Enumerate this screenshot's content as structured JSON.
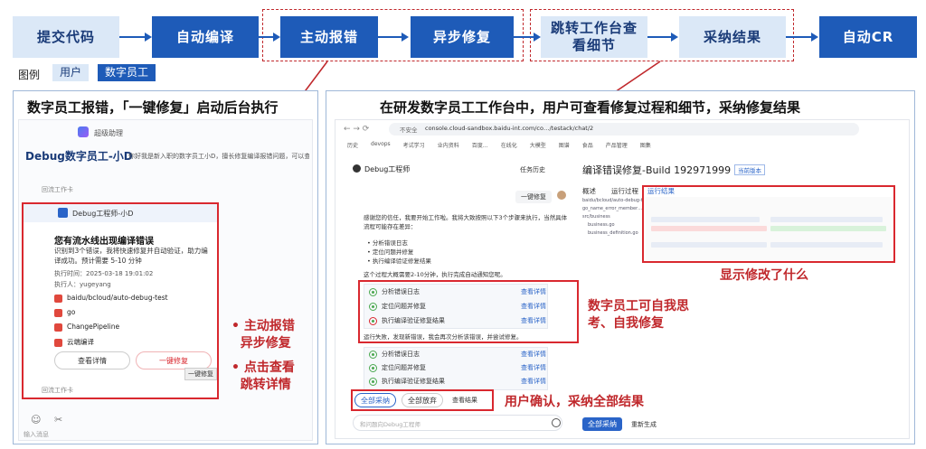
{
  "flow": {
    "steps": [
      {
        "label": "提交代码",
        "role": "user"
      },
      {
        "label": "自动编译",
        "role": "employee"
      },
      {
        "label": "主动报错",
        "role": "employee"
      },
      {
        "label": "异步修复",
        "role": "employee"
      },
      {
        "label": "跳转工作台查看细节",
        "role": "user"
      },
      {
        "label": "采纳结果",
        "role": "user"
      },
      {
        "label": "自动CR",
        "role": "employee"
      }
    ]
  },
  "legend": {
    "title": "图例",
    "user": "用户",
    "employee": "数字员工"
  },
  "colors": {
    "user_fill": "#dbe8f7",
    "employee_fill": "#1e5bb8",
    "accent_red": "#c0282c"
  },
  "left_panel": {
    "title": "数字员工报错，「一键修复」启动后台执行",
    "app_name": "超级助理",
    "chat_title": "Debug数字员工-小D",
    "chat_intro": "你好我是新入职的数字员工小D，擅长修复编译报错问题，可以查...",
    "back_label_top": "回流工作卡",
    "card": {
      "sender": "Debug工程师-小D",
      "heading": "您有流水线出现编译错误",
      "message": "识别到3个错误，我将快速修复并自动验证，助力编译成功。预计需要 5-10 分钟",
      "exec_time": "执行时间：2025-03-18 19:01:02",
      "executor": "执行人：yugeyang",
      "repo": "baidu/bcloud/auto-debug-test",
      "lang": "go",
      "pipeline": "ChangePipeline",
      "env": "云端编译",
      "detail_button": "查看详情",
      "fix_button": "一键修复",
      "tooltip": "一键修复"
    },
    "back_label_bottom": "回流工作卡",
    "input_placeholder": "输入消息",
    "notes": [
      "主动报错",
      "异步修复",
      "点击查看",
      "跳转详情"
    ]
  },
  "right_panel": {
    "title": "在研发数字员工工作台中，用户可查看修复过程和细节，采纳修复结果",
    "url": "console.cloud-sandbox.baidu-int.com/co…/testack/chat/2",
    "url_prefix": "不安全",
    "bookmarks": [
      "历史",
      "devops",
      "考试学习",
      "业内资料",
      "百度…",
      "在线化",
      "大模型",
      "图谱",
      "食品",
      "产品管理",
      "图集"
    ],
    "agent_name": "Debug工程师",
    "task_history": "任务历史",
    "user_message": "一键修复",
    "agent_reply": "感谢您的信任，我要开始工作啦。我将大致按照以下3个步骤来执行，当然具体流程可能存在差异：",
    "plan": [
      "分析错误日志",
      "定位问题并修复",
      "执行编译验证修复结果"
    ],
    "eta": "这个过程大概需要2-10分钟，执行完成自动通知您呢。",
    "steps_round1": [
      "分析错误日志",
      "定位问题并修复",
      "执行编译验证修复结果"
    ],
    "steps_round2": [
      "分析错误日志",
      "定位问题并修复",
      "执行编译验证修复结果"
    ],
    "view_detail": "查看详情",
    "retry_note": "运行失败，发现新错误，我会再次分析该错误，并尝试修复。",
    "accept_all": "全部采纳",
    "reject_all": "全部放弃",
    "view_result": "查看结果",
    "input_placeholder": "和问题向Debug工程师",
    "build_title": "编译错误修复-Build 192971999",
    "build_badge": "当前版本",
    "tabs": [
      "概述",
      "运行过程",
      "运行结果"
    ],
    "file_tree": [
      "baidu/bcloud/auto-debug-t…",
      "go_name_error_member…",
      "src/business",
      "business.go",
      "business_definition.go"
    ],
    "accept_all_bottom": "全部采纳",
    "regenerate": "重新生成",
    "notes": {
      "self_fix": "数字员工可自我思考、自我修复",
      "show_changes": "显示修改了什么",
      "user_confirm": "用户确认，采纳全部结果"
    }
  }
}
